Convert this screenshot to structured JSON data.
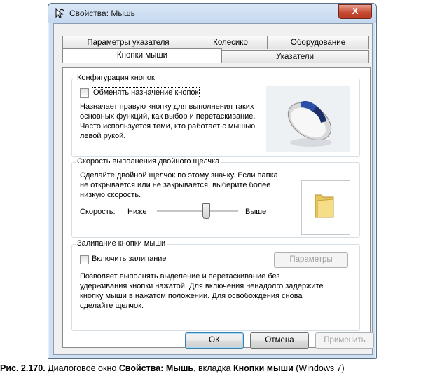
{
  "window": {
    "title": "Свойства: Мышь",
    "close_label": "X"
  },
  "tabs_back": [
    "Параметры указателя",
    "Колесико",
    "Оборудование"
  ],
  "tabs_front": [
    "Кнопки мыши",
    "Указатели"
  ],
  "config": {
    "group_label": "Конфигурация кнопок",
    "swap_label": "Обменять назначение кнопок",
    "description": "Назначает правую кнопку для выполнения таких основных функций, как выбор и перетаскивание. Часто используется теми, кто работает с мышью левой рукой."
  },
  "dblclick": {
    "group_label": "Скорость выполнения двойного щелчка",
    "description": "Сделайте двойной щелчок по этому значку. Если папка не открывается или не закрывается, выберите более низкую скорость.",
    "speed_label": "Скорость:",
    "slow_label": "Ниже",
    "fast_label": "Выше",
    "speed_level": 0.6
  },
  "clicklock": {
    "group_label": "Залипание кнопки мыши",
    "enable_label": "Включить залипание",
    "settings_label": "Параметры",
    "description": "Позволяет выполнять выделение и перетаскивание без удерживания кнопки нажатой. Для включения ненадолго задержите кнопку мыши в нажатом положении. Для освобождения снова сделайте щелчок."
  },
  "buttons": {
    "ok": "ОК",
    "cancel": "Отмена",
    "apply": "Применить"
  },
  "caption": {
    "prefix": "Рис. 2.170.",
    "text1": " Диалоговое окно ",
    "bold1": "Свойства: Мышь",
    "text2": ", вкладка ",
    "bold2": "Кнопки мыши",
    "text3": " (Windows 7)"
  }
}
